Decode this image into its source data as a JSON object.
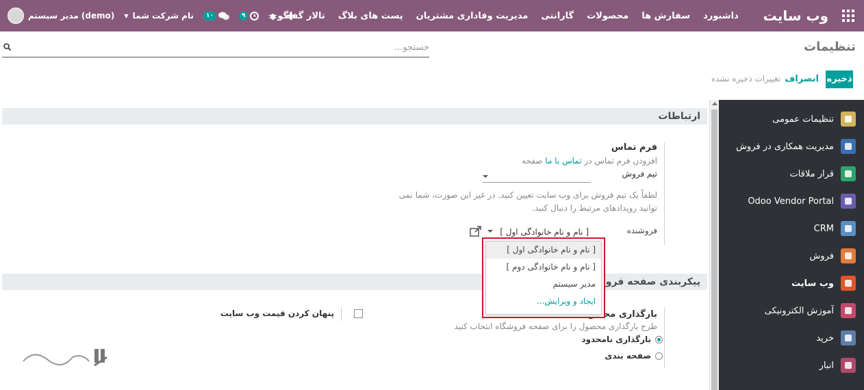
{
  "topbar": {
    "brand": "وب سایت",
    "menu": [
      "داشبورد",
      "سفارش ها",
      "محصولات",
      "گارانتی",
      "مدیریت وفاداری مشتریان",
      "پست های بلاگ",
      "تالار گفتگو"
    ],
    "company": "نام شرکت شما",
    "user": "مدیر سیستم (demo)",
    "messages_count": "۱۰",
    "activity_count": "۹"
  },
  "control_panel": {
    "title": "تنظیمات",
    "search_placeholder": "جستجو...",
    "save_label": "ذخیره",
    "cancel_label": "انصراف",
    "unsaved_label": "تغییرات ذخیره نشده"
  },
  "sidebar": {
    "items": [
      {
        "label": "تنظیمات عمومی",
        "color": "#d2b35f"
      },
      {
        "label": "مدیریت همکاری در فروش",
        "color": "#3b6fb0"
      },
      {
        "label": "قرار ملاقات",
        "color": "#2fa36e"
      },
      {
        "label": "Odoo Vendor Portal",
        "color": "#6b5cad"
      },
      {
        "label": "CRM",
        "color": "#5a8fc6"
      },
      {
        "label": "فروش",
        "color": "#e27c3b"
      },
      {
        "label": "وب سایت",
        "color": "#e0552c"
      },
      {
        "label": "آموزش الکترونیکی",
        "color": "#c44a6b"
      },
      {
        "label": "خرید",
        "color": "#5b7fa8"
      },
      {
        "label": "انبار",
        "color": "#b0486b"
      }
    ]
  },
  "section_communication": {
    "title": "ارتباطات",
    "contact_form_title": "فرم تماس",
    "contact_form_desc_prefix": "افزودن فرم تماس در",
    "contact_form_link": "تماس با ما",
    "contact_form_desc_suffix": "صفحه",
    "sales_team_label": "تیم فروش",
    "sales_team_help": "لطفاً یک تیم فروش برای وب سایت تعیین کنید. در غیر این صورت، شما نمی توانید رویدادهای مرتبط را دنبال کنید.",
    "salesperson_label": "فروشنده",
    "salesperson_value": "[ نام و نام خانوادگی اول ]"
  },
  "dropdown": {
    "options": [
      "[ نام و نام خانوادگی اول ]",
      "[ نام و نام خانوادگی دوم ]",
      "مدیر سیستم"
    ],
    "create_edit": "ایجاد و ویرایش..."
  },
  "section_shop": {
    "title": "پیکربندی صفحه فرو",
    "product_loading_title": "بارگذاری محصول",
    "product_loading_desc": "طرح بارگذاری محصول را برای صفحه فروشگاه انتخاب کنید",
    "option_unlimited": "بارگذاری نامحدود",
    "option_paging": "صفحه بندی",
    "hide_price_label": "پنهان کردن قیمت وب سایت"
  },
  "watermark": "تسیر گستر"
}
